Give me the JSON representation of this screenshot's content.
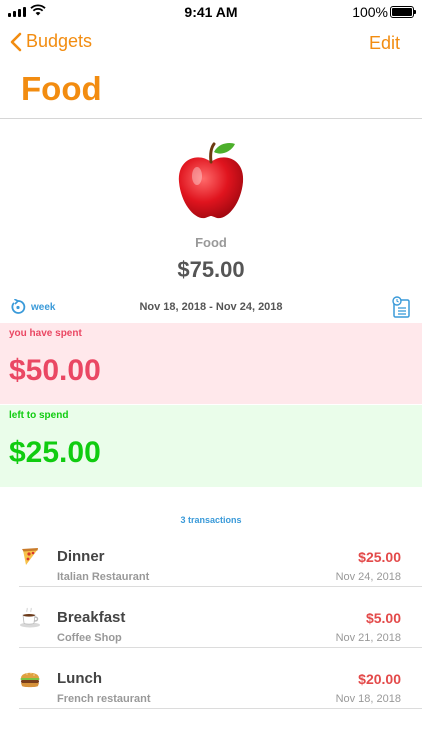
{
  "status_bar": {
    "time": "9:41 AM",
    "battery": "100%"
  },
  "nav": {
    "back_label": "Budgets",
    "edit_label": "Edit",
    "title": "Food"
  },
  "budget": {
    "icon": "apple-icon",
    "name": "Food",
    "amount": "$75.00"
  },
  "period": {
    "label": "week",
    "range": "Nov 18, 2018 - Nov 24, 2018"
  },
  "spent": {
    "label": "you have spent",
    "value": "$50.00"
  },
  "remaining": {
    "label": "left to spend",
    "value": "$25.00"
  },
  "transactions": {
    "count_label": "3 transactions",
    "items": [
      {
        "icon": "pizza-icon",
        "title": "Dinner",
        "place": "Italian Restaurant",
        "amount": "$25.00",
        "date": "Nov 24, 2018"
      },
      {
        "icon": "coffee-icon",
        "title": "Breakfast",
        "place": "Coffee Shop",
        "amount": "$5.00",
        "date": "Nov 21, 2018"
      },
      {
        "icon": "burger-icon",
        "title": "Lunch",
        "place": "French restaurant",
        "amount": "$20.00",
        "date": "Nov 18, 2018"
      }
    ]
  },
  "colors": {
    "accent": "#f28c10",
    "spent": "#ea4763",
    "remaining": "#10cc10",
    "link": "#3a9ad9"
  }
}
